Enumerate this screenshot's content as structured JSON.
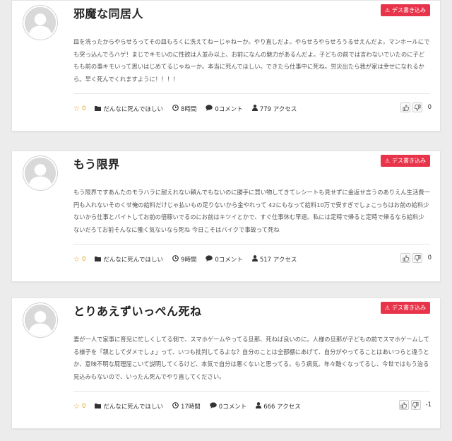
{
  "posts": [
    {
      "title": "邪魔な同居人",
      "badge": "デス書き込み",
      "body": "皿を洗ったからやらせろってその皿もろくに洗えてねーじゃねーか。やり直しだよ。やらせろやらせろうるせえんだよ。マンホールにでも突っ込んでろハゲ！まじでキモいのに性欲は人並み以上、お前になんの魅力があるんだよ。子どもの前では言わないでいたのに子どもも前の事キモいって思いはじめてるじゃねーか。本当に死んでほしい。できたら仕事中に死ね。労災出たら我が家は幸せになれるから。早く死んでくれますように！！！！",
      "stars": "0",
      "category": "だんなに死んでほしい",
      "time": "8時間",
      "comments": "0コメント",
      "views": "779 アクセス",
      "vote": "0"
    },
    {
      "title": "もう限界",
      "badge": "デス書き込み",
      "body": "もう限界ですあんたのモラハラに耐えれない頼んでもないのに勝手に買い物してきてレシートも見せずに金返せ言うのありえん生活費一円も入れないそのくせ俺の給料だけじゃ払いもの足りないから金やれって 42にもなって給料10万で安すぎでしょこっちはお前の給料少ないから仕事とバイトしてお前の倍稼いでるのにお前はキツイとかで、すぐ仕事休む早退。私には定時で帰ると定時で帰るなら給料少ないだろてお前そんなに働く気ないなら死ね 今日こそはバイクで事故って死ね",
      "stars": "0",
      "category": "だんなに死んでほしい",
      "time": "9時間",
      "comments": "0コメント",
      "views": "517 アクセス",
      "vote": "0"
    },
    {
      "title": "とりあえずいっぺん死ね",
      "badge": "デス書き込み",
      "body": "妻が一人で家事に育児に忙しくしてる側で、スマホゲームやってる旦那、死ねば良いのに。人様の旦那が子どもの前でスマホゲームしてる様子を「親としてダメでしょ」って、いつも批判してるよな？自分のことは全部棚にあげて、自分がやってることはあいつらと違うとか、意味不明な屁理屈こいて説明してくるけど、本気で自分は悪くないと思ってる。もう病気。年々酷くなってるし、今世ではもう治る見込みもないので、いったん死んでやり直してください。",
      "stars": "0",
      "category": "だんなに死んでほしい",
      "time": "17時間",
      "comments": "0コメント",
      "views": "666 アクセス",
      "vote": "-1"
    }
  ],
  "icons": {
    "star": "star-outline-icon",
    "folder": "folder-icon",
    "clock": "clock-icon",
    "comment": "speech-bubble-icon",
    "user": "user-icon",
    "thumbs_up": "thumbs-up-icon",
    "thumbs_down": "thumbs-down-icon",
    "badge": "warning-icon"
  },
  "colors": {
    "badge": "#e8344a",
    "star": "#e0a030",
    "background": "#ececec"
  }
}
